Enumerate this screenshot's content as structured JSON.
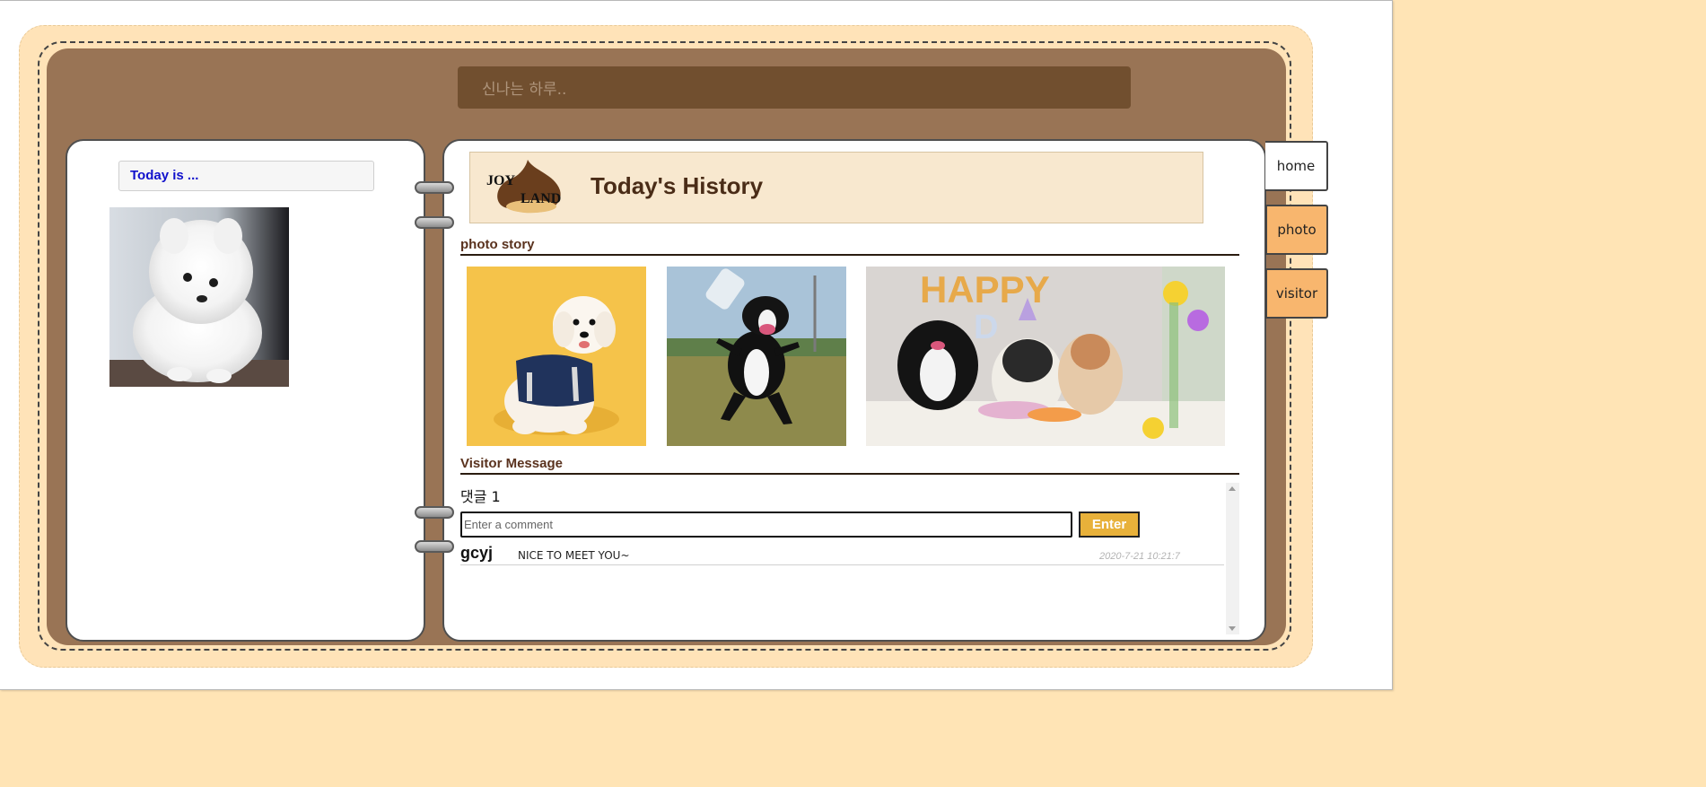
{
  "header": {
    "site_title": "신나는 하루.."
  },
  "left_page": {
    "today_label": "Today is ..."
  },
  "right_page": {
    "logo_text": "JOY LAND",
    "title": "Today's History",
    "photo_section": "photo story",
    "visitor_section": "Visitor Message",
    "comments": {
      "count_label": "댓글 1",
      "input_placeholder": "Enter a comment",
      "enter_label": "Enter",
      "items": [
        {
          "user": "gcyj",
          "text": "NICE TO MEET YOU~",
          "date": "2020-7-21 10:21:7"
        }
      ]
    }
  },
  "tabs": [
    {
      "label": "home"
    },
    {
      "label": "photo"
    },
    {
      "label": "visitor"
    }
  ],
  "colors": {
    "background": "#ffe4b5",
    "cover": "#ffe3b8",
    "board": "#997455",
    "title_bar": "#714f2f",
    "tab_active": "#ffffff",
    "tab_inactive": "#f8b66e",
    "enter_button": "#e8b13a"
  }
}
